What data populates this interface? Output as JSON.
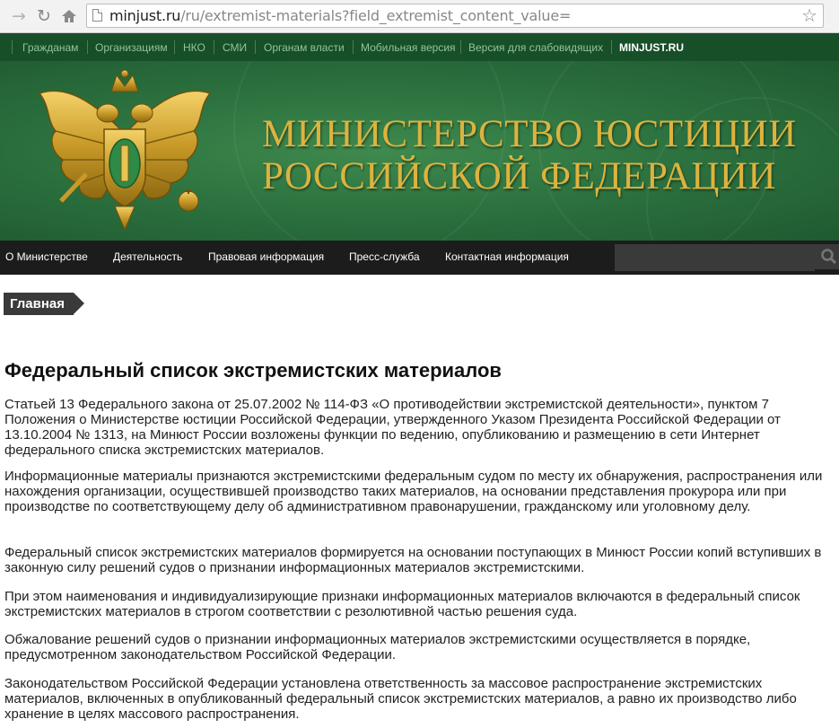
{
  "browser": {
    "url_domain": "minjust.ru",
    "url_path": "/ru/extremist-materials?field_extremist_content_value=",
    "back_icon": "arrow-right-icon",
    "forward_icon": "arrow-right-icon",
    "reload_icon": "reload-icon",
    "home_icon": "home-icon",
    "bookmark_icon": "star-icon"
  },
  "topbar": {
    "links": [
      "Гражданам",
      "Организациям",
      "НКО",
      "СМИ",
      "Органам власти",
      "Мобильная версия",
      "Версия для слабовидящих"
    ],
    "brand": "MINJUST.RU"
  },
  "header": {
    "title_line1": "МИНИСТЕРСТВО ЮСТИЦИИ",
    "title_line2": "РОССИЙСКОЙ ФЕДЕРАЦИИ"
  },
  "mainnav": {
    "items": [
      "О Министерстве",
      "Деятельность",
      "Правовая информация",
      "Пресс-служба",
      "Контактная информация"
    ],
    "search_value": ""
  },
  "breadcrumb": "Главная",
  "content": {
    "title": "Федеральный список экстремистских материалов",
    "paragraphs": [
      "Статьей 13 Федерального закона от 25.07.2002 № 114-ФЗ «О противодействии экстремистской деятельности», пунктом 7 Положения о Министерстве юстиции Российской Федерации, утвержденного Указом Президента Российской Федерации от 13.10.2004 № 1313, на Минюст России возложены функции по ведению, опубликованию и размещению в сети Интернет федерального списка экстремистских материалов.",
      "Информационные материалы признаются экстремистскими федеральным судом по месту их обнаружения, распространения или нахождения организации, осуществившей производство таких материалов, на основании представления прокурора или при производстве по соответствующему делу об административном правонарушении, гражданскому или уголовному делу.",
      "Федеральный список экстремистских материалов формируется на основании поступающих в Минюст России копий вступивших в законную силу решений судов о признании информационных материалов экстремистскими.",
      "При этом наименования и индивидуализирующие признаки информационных материалов включаются в федеральный список экстремистских материалов в строгом соответствии с резолютивной частью решения суда.",
      "Обжалование решений судов о признании информационных материалов экстремистскими осуществляется в порядке, предусмотренном законодательством Российской Федерации.",
      "Законодательством Российской Федерации установлена ответственность за массовое распространение экстремистских материалов, включенных в опубликованный федеральный список экстремистских материалов, а равно их производство либо хранение в целях массового распространения."
    ]
  },
  "colors": {
    "topbar_bg": "#174f28",
    "topbar_link": "#8fc59c",
    "banner_green": "#2d7340",
    "title_gold": "#dcb33f",
    "nav_bg": "#1c1c1c",
    "crumb_bg": "#3a3a3a"
  }
}
